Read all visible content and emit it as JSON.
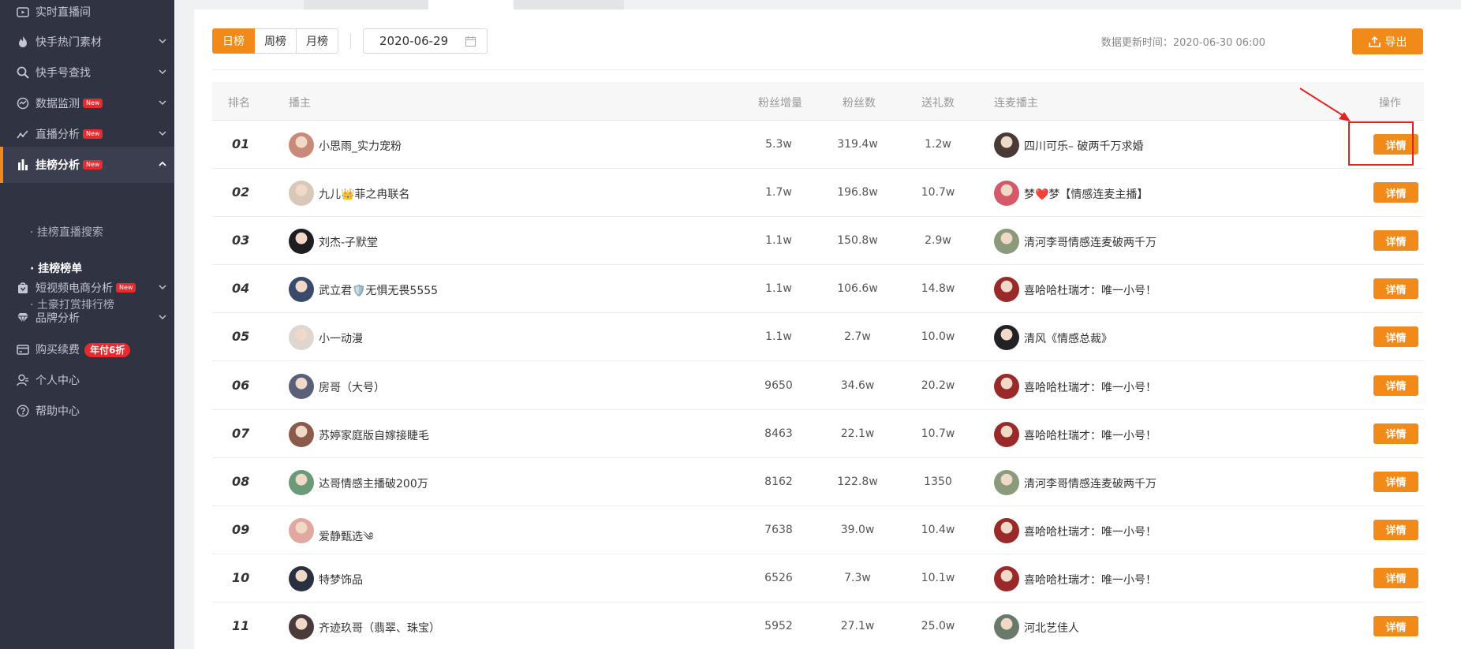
{
  "sidebar": {
    "items": [
      {
        "label": "实时直播间",
        "icon": "live-room-icon",
        "chevron": false
      },
      {
        "label": "快手热门素材",
        "icon": "flame-icon",
        "chevron": true
      },
      {
        "label": "快手号查找",
        "icon": "search-icon",
        "chevron": true
      },
      {
        "label": "数据监测",
        "icon": "monitor-icon",
        "chevron": true,
        "badge": "New"
      },
      {
        "label": "直播分析",
        "icon": "trend-icon",
        "chevron": true,
        "badge": "New"
      },
      {
        "label": "挂榜分析",
        "icon": "bar-chart-icon",
        "chevron": true,
        "badge": "New",
        "active": true
      },
      {
        "label": "短视频电商分析",
        "icon": "shopping-bag-icon",
        "chevron": true,
        "badge": "New"
      },
      {
        "label": "品牌分析",
        "icon": "diamond-icon",
        "chevron": true
      },
      {
        "label": "购买续费",
        "icon": "card-icon",
        "chevron": false,
        "promo": "年付6折"
      },
      {
        "label": "个人中心",
        "icon": "user-icon",
        "chevron": false
      },
      {
        "label": "帮助中心",
        "icon": "help-icon",
        "chevron": false
      }
    ],
    "subitems": [
      "· 挂榜直播搜索",
      "· 挂榜榜单",
      "· 土豪打赏排行榜"
    ]
  },
  "toolbar": {
    "periods": [
      "日榜",
      "周榜",
      "月榜"
    ],
    "date": "2020-06-29",
    "update_time": "数据更新时间：2020-06-30 06:00",
    "export_label": "导出"
  },
  "table": {
    "headers": [
      "排名",
      "播主",
      "粉丝增量",
      "粉丝数",
      "送礼数",
      "连麦播主",
      "操作"
    ],
    "action_label": "详情",
    "rows": [
      {
        "rank": "01",
        "name": "小思雨_实力宠粉",
        "fan_gain": "5.3w",
        "fans": "319.4w",
        "gifts": "1.2w",
        "partner": "四川可乐– 破两千万求婚",
        "av": "#c98a7a",
        "pav": "#4a3a36"
      },
      {
        "rank": "02",
        "name": "九儿👑菲之冉联名",
        "fan_gain": "1.7w",
        "fans": "196.8w",
        "gifts": "10.7w",
        "partner": "梦❤️梦【情感连麦主播】",
        "av": "#d8c8b8",
        "pav": "#d45a6a"
      },
      {
        "rank": "03",
        "name": "刘杰-子默堂",
        "fan_gain": "1.1w",
        "fans": "150.8w",
        "gifts": "2.9w",
        "partner": "清河李哥情感连麦破两千万",
        "av": "#1e1e22",
        "pav": "#8a9a7a"
      },
      {
        "rank": "04",
        "name": "武立君🛡️无惧无畏5555",
        "fan_gain": "1.1w",
        "fans": "106.6w",
        "gifts": "14.8w",
        "partner": "喜哈哈杜瑞才：唯一小号！",
        "av": "#3a4a6a",
        "pav": "#9a2a2a"
      },
      {
        "rank": "05",
        "name": "小一动漫",
        "fan_gain": "1.1w",
        "fans": "2.7w",
        "gifts": "10.0w",
        "partner": "清风《情感总裁》",
        "av": "#e0d6d0",
        "pav": "#222226"
      },
      {
        "rank": "06",
        "name": "房哥（大号）",
        "fan_gain": "9650",
        "fans": "34.6w",
        "gifts": "20.2w",
        "partner": "喜哈哈杜瑞才：唯一小号！",
        "av": "#5a6078",
        "pav": "#9a2a2a"
      },
      {
        "rank": "07",
        "name": "苏婷家庭版自嫁接睫毛",
        "fan_gain": "8463",
        "fans": "22.1w",
        "gifts": "10.7w",
        "partner": "喜哈哈杜瑞才：唯一小号！",
        "av": "#8a5a4a",
        "pav": "#9a2a2a"
      },
      {
        "rank": "08",
        "name": "达哥情感主播破200万",
        "fan_gain": "8162",
        "fans": "122.8w",
        "gifts": "1350",
        "partner": "清河李哥情感连麦破两千万",
        "av": "#6a9a7a",
        "pav": "#8a9a7a"
      },
      {
        "rank": "09",
        "name": "爱静甄选༄",
        "fan_gain": "7638",
        "fans": "39.0w",
        "gifts": "10.4w",
        "partner": "喜哈哈杜瑞才：唯一小号！",
        "av": "#e0a8a0",
        "pav": "#9a2a2a"
      },
      {
        "rank": "10",
        "name": "特梦饰品",
        "fan_gain": "6526",
        "fans": "7.3w",
        "gifts": "10.1w",
        "partner": "喜哈哈杜瑞才：唯一小号！",
        "av": "#2a3040",
        "pav": "#9a2a2a"
      },
      {
        "rank": "11",
        "name": "齐迹玖哥（翡翠、珠宝）",
        "fan_gain": "5952",
        "fans": "27.1w",
        "gifts": "25.0w",
        "partner": "河北艺佳人",
        "av": "#4a3a3a",
        "pav": "#6a7a6a"
      }
    ]
  },
  "colors": {
    "accent": "#f28a1a",
    "sidebar_bg": "#2f3342",
    "badge": "#e8292e",
    "highlight": "#e02424"
  }
}
